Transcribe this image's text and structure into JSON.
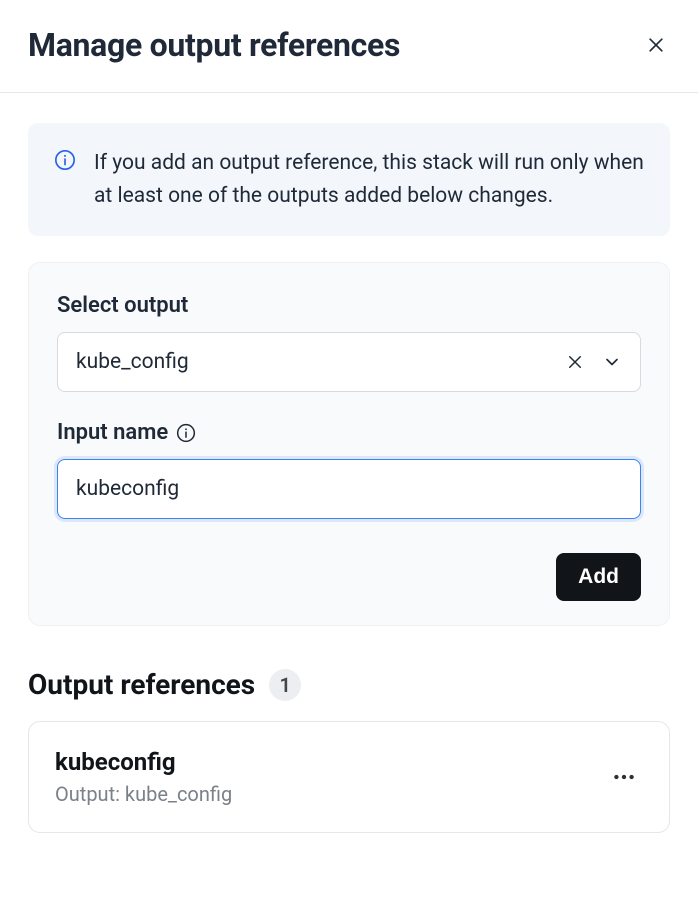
{
  "header": {
    "title": "Manage output references"
  },
  "info_banner": {
    "text": "If you add an output reference, this stack will run only when at least one of the outputs added below changes."
  },
  "form": {
    "select_output": {
      "label": "Select output",
      "value": "kube_config"
    },
    "input_name": {
      "label": "Input name",
      "value": "kubeconfig"
    },
    "add_button": "Add"
  },
  "references": {
    "heading": "Output references",
    "count": "1",
    "items": [
      {
        "name": "kubeconfig",
        "output_label": "Output: kube_config"
      }
    ]
  }
}
